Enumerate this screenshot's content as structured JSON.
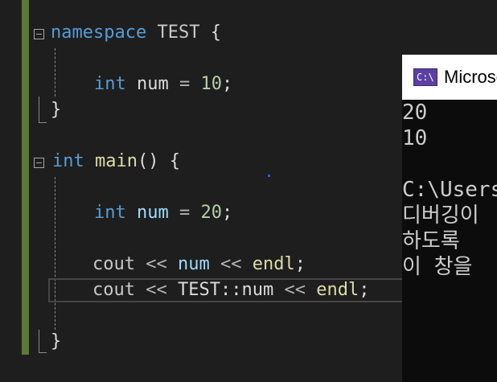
{
  "editor": {
    "lines": [
      {
        "id": "ns-open",
        "tokens": {
          "kw": "namespace",
          "sp1": " ",
          "name": "TEST",
          "sp2": " ",
          "brace": "{"
        }
      },
      {
        "id": "ns-var",
        "tokens": {
          "type": "int",
          "sp1": " ",
          "name": "num",
          "sp2": " ",
          "op": "=",
          "sp3": " ",
          "value": "10",
          "semi": ";"
        }
      },
      {
        "id": "ns-close",
        "tokens": {
          "brace": "}"
        }
      },
      {
        "id": "main-open",
        "tokens": {
          "type": "int",
          "sp1": " ",
          "name": "main",
          "parens": "()",
          "sp2": " ",
          "brace": "{"
        }
      },
      {
        "id": "main-var",
        "tokens": {
          "type": "int",
          "sp1": " ",
          "name": "num",
          "sp2": " ",
          "op": "=",
          "sp3": " ",
          "value": "20",
          "semi": ";"
        }
      },
      {
        "id": "cout-1",
        "tokens": {
          "cout": "cout",
          "sp1": " ",
          "op1": "<<",
          "sp2": " ",
          "name": "num",
          "sp3": " ",
          "op2": "<<",
          "sp4": " ",
          "endl": "endl",
          "semi": ";"
        }
      },
      {
        "id": "cout-2",
        "tokens": {
          "cout": "cout",
          "sp1": " ",
          "op1": "<<",
          "sp2": " ",
          "scope": "TEST::num",
          "sp3": " ",
          "op2": "<<",
          "sp4": " ",
          "endl": "endl",
          "semi": ";"
        }
      },
      {
        "id": "main-close",
        "tokens": {
          "brace": "}"
        }
      }
    ]
  },
  "console": {
    "title": "Microsoft Visual Studio 디버그 콘솔",
    "icon_label": "C:\\",
    "output": [
      "20",
      "10",
      "",
      "C:\\Users",
      "디버깅이",
      "하도록 ",
      "이 창을"
    ]
  },
  "colors": {
    "background": "#1e1e1e",
    "keyword": "#569cd6",
    "number": "#b5cea8",
    "variable": "#9cdcfe",
    "function": "#dcdcaa",
    "change_bar": "#5b7a33"
  }
}
